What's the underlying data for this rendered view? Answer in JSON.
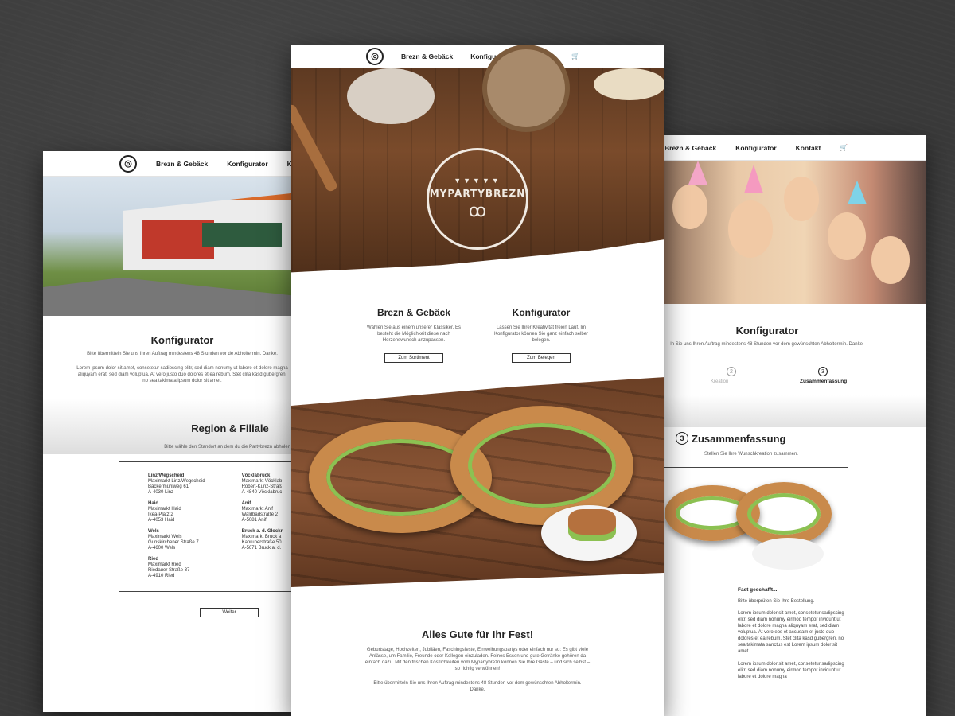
{
  "nav": {
    "logo": "◎",
    "items": [
      "Brezn & Gebäck",
      "Konfigurator",
      "Kontakt"
    ],
    "cart_icon": "cart-icon",
    "cart_glyph": "🛒"
  },
  "left": {
    "nav_partial": "Ko",
    "title": "Konfigurator",
    "intro": "Bitte übermitteln Sie uns Ihren Auftrag mindestens 48 Stunden vor de Abholtermin. Danke.",
    "lorem": "Lorem ipsum dolor sit amet, consetetur sadipscing elitr, sed diam nonumy ut labore et dolore magna aliquyam erat, sed diam voluptua. At vero justo duo dolores et ea rebum. Stet clita kasd gubergren, no sea takimata ipsum dolor sit amet.",
    "region_title": "Region & Filiale",
    "region_sub": "Bitte wähle den Standort an dem du die Partybrezn abholen m",
    "stores_col1": [
      {
        "name": "Linz/Wegscheid",
        "lines": [
          "Maximarkt Linz/Wegscheid",
          "Bäckermühlweg 61",
          "A-4030 Linz"
        ]
      },
      {
        "name": "Haid",
        "lines": [
          "Maximarkt Haid",
          "Ikea-Platz 2",
          "A-4053 Haid"
        ]
      },
      {
        "name": "Wels",
        "lines": [
          "Maximarkt Wels",
          "Gunskirchener Straße 7",
          "A-4600 Wels"
        ]
      },
      {
        "name": "Ried",
        "lines": [
          "Maximarkt Ried",
          "Riedauer Straße 37",
          "A-4910 Ried"
        ]
      }
    ],
    "stores_col2": [
      {
        "name": "Vöcklabruck",
        "lines": [
          "Maximarkt Vöcklab",
          "Robert-Kunz-Straß",
          "A-4840 Vöcklabruc"
        ]
      },
      {
        "name": "Anif",
        "lines": [
          "Maximarkt Anif",
          "Waldbadstraße 2",
          "A-5081 Anif"
        ]
      },
      {
        "name": "Bruck a. d. Glockn",
        "lines": [
          "Maximarkt Bruck a",
          "Kaprunerstraße 50",
          "A-5671 Bruck a. d."
        ]
      }
    ],
    "next_button": "Weiter"
  },
  "center": {
    "badge_text": "MYPARTYBREZN",
    "col1": {
      "title": "Brezn & Gebäck",
      "text": "Wählen Sie aus einem unserer Klassiker. Es besteht die Möglichkeit diese nach Herzenswunsch anzupassen.",
      "button": "Zum Sortiment"
    },
    "col2": {
      "title": "Konfigurator",
      "text": "Lassen Sie Ihrer Kreativität freien Lauf. Im Konfigurator können Sie ganz einfach selber belegen.",
      "button": "Zum Belegen"
    },
    "fest_title": "Alles Gute für Ihr Fest!",
    "fest_text": "Geburtstage, Hochzeiten, Jubiläen, Faschingsfeste, Einweihungspartys oder einfach nur so: Es gibt viele Anlässe, um Familie, Freunde oder Kollegen einzuladen. Feines Essen und gute Getränke gehören da einfach dazu. Mit den frischen Köstlichkeiten vom Mypartybrezn können Sie Ihre Gäste – und sich selbst – so richtig verwöhnen!",
    "fest_note": "Bitte übermitteln Sie uns Ihren Auftrag mindestens 48 Stunden vor dem gewünschten Abholtermin. Danke."
  },
  "right": {
    "title": "Konfigurator",
    "intro": "ln Sie uns Ihren Auftrag mindestens 48 Stunden vor dem gewünschten Abholtermin. Danke.",
    "step2_num": "2",
    "step2_label": "Kreation",
    "step3_num": "3",
    "step3_label": "Zusammenfassung",
    "summary_num": "3",
    "summary_title": "Zusammenfassung",
    "summary_sub": "Stellen Sie Ihre Wunschkreation zusammen.",
    "done_title": "Fast geschafft...",
    "done_sub": "Bitte überprüfen Sie Ihre Bestellung.",
    "lorem1": "Lorem ipsum dolor sit amet, consetetur sadipscing elitr, sed diam nonumy eirmod tempor invidunt ut labore et dolore magna aliquyam erat, sed diam voluptua. At vero eos et accusam et justo duo dolores et ea rebum. Stet clita kasd gubergren, no sea takimata sanctus est Lorem ipsum dolor sit amet.",
    "lorem2": "Lorem ipsum dolor sit amet, consetetur sadipscing elitr, sed diam nonumy eirmod tempor invidunt ut labore et dolore magna"
  }
}
